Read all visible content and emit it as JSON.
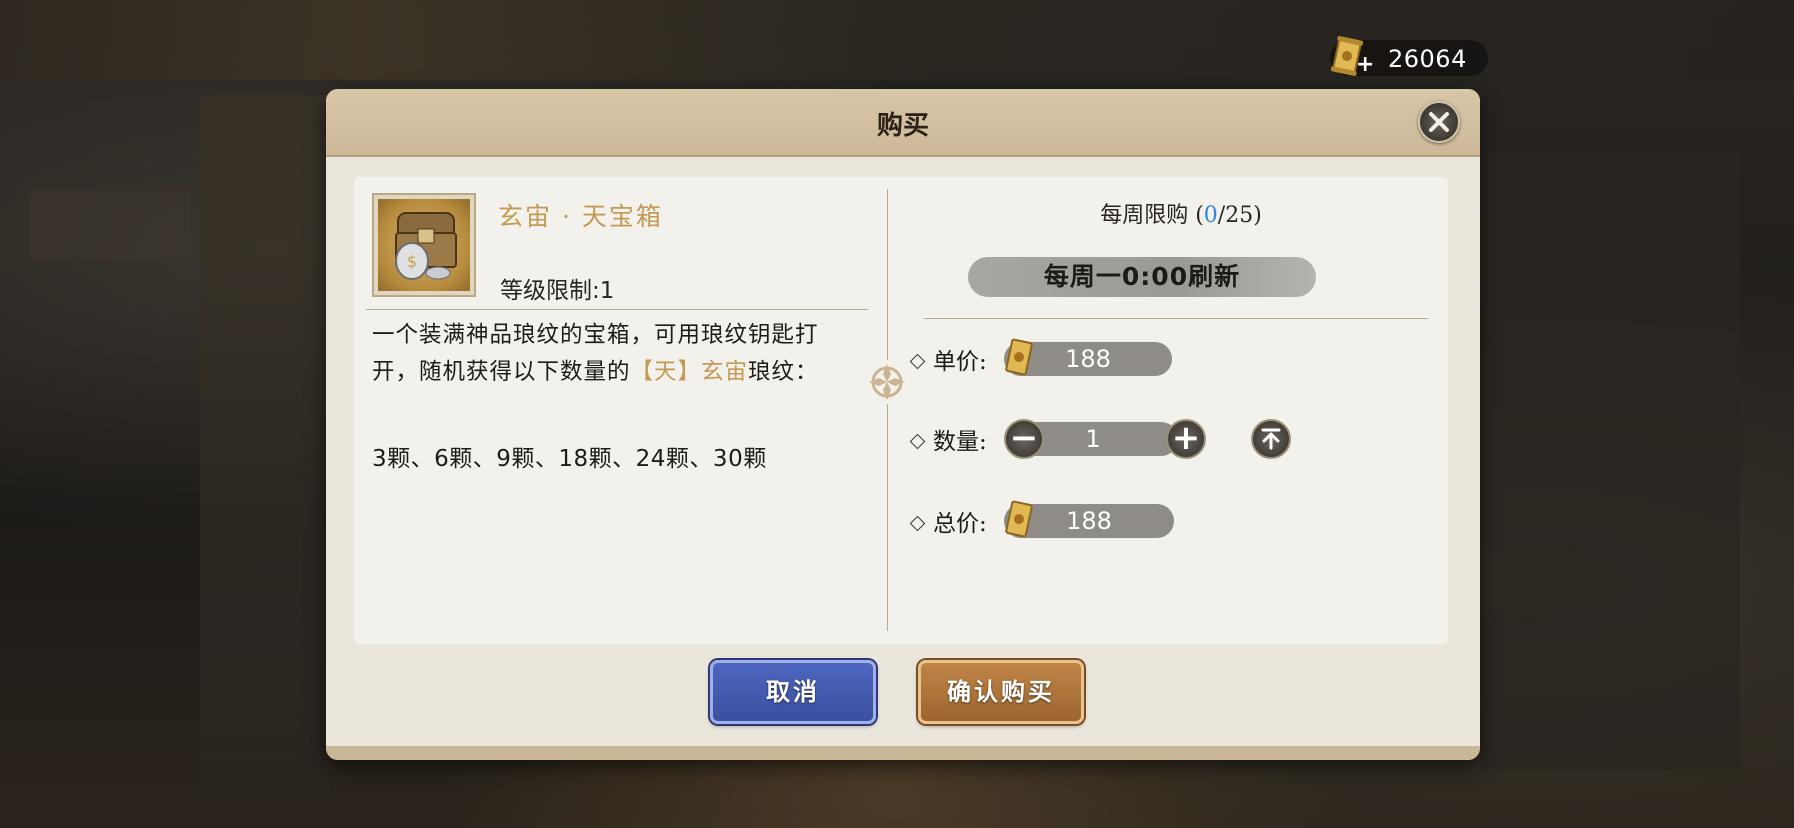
{
  "currency": {
    "amount": "26064",
    "icon": "scroll-ticket-icon",
    "add_icon": "plus-icon"
  },
  "dialog": {
    "title": "购买",
    "item": {
      "name": "玄宙 · 天宝箱",
      "level_limit": "等级限制:1",
      "icon": "treasure-chest-icon",
      "description_parts": [
        "一个装满神品琅纹的宝箱，可用琅纹钥匙打开，随机获得以下数量的",
        "【天】玄宙",
        "琅纹："
      ],
      "counts": "3颗、6颗、9颗、18颗、24颗、30颗"
    },
    "weekly_limit": {
      "prefix": "每周限购",
      "open": "(",
      "current": "0",
      "sep": "/",
      "max": "25",
      "close": ")"
    },
    "refresh_text": "每周一0:00刷新",
    "unit_price": {
      "label": "单价:",
      "value": "188"
    },
    "quantity": {
      "label": "数量:",
      "value": "1",
      "minus": "−",
      "plus": "+"
    },
    "total_price": {
      "label": "总价:",
      "value": "188"
    },
    "buttons": {
      "cancel": "取消",
      "confirm": "确认购买"
    }
  },
  "colors": {
    "accent_gold": "#c39a55",
    "limit_blue": "#2a88d8",
    "cancel_blue": "#3a4f9f",
    "confirm_brown": "#9c6530"
  }
}
